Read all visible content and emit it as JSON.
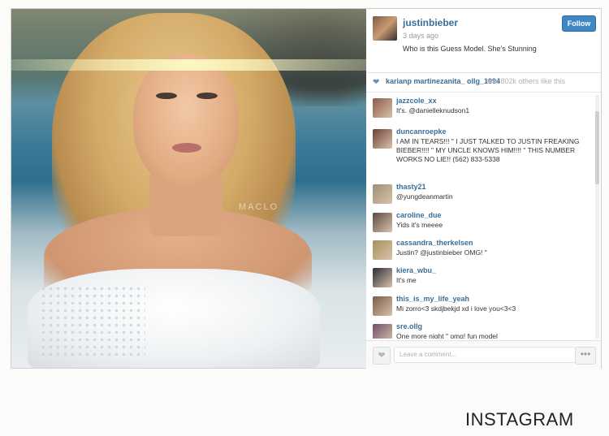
{
  "photo": {
    "watermark": "MACLO"
  },
  "post": {
    "username": "justinbieber",
    "time": "3 days ago",
    "caption": "Who is this Guess Model. She's Stunning",
    "follow_label": "Follow",
    "likes_names": "karianp  martinezanita_  ollg_1994",
    "likes_more": "and 802k others like this"
  },
  "comments": [
    {
      "user": "jazzcole_xx",
      "text": "It's. @danielleknudson1",
      "avatar_color": "#8a5a4a"
    },
    {
      "user": "duncanroepke",
      "text": "I AM IN TEARS!!! \" I JUST TALKED TO JUSTIN FREAKING BIEBER!!!! \" MY UNCLE KNOWS HIM!!!! \" THIS NUMBER WORKS NO LIE!! (562) 833-5338",
      "avatar_color": "#6b3f3a"
    },
    {
      "user": "thasty21",
      "text": "@yungdeanmartin",
      "avatar_color": "#9c8f78"
    },
    {
      "user": "caroline_due",
      "text": "Yids it's meeee",
      "avatar_color": "#5e4b43"
    },
    {
      "user": "cassandra_therkelsen",
      "text": "Justin? @justinbieber OMG! \"",
      "avatar_color": "#a79160"
    },
    {
      "user": "kiera_wbu_",
      "text": "It's me",
      "avatar_color": "#2b2b3a"
    },
    {
      "user": "this_is_my_life_yeah",
      "text": "Mi zorro<3 skdjbekjd xd i love you<3<3",
      "avatar_color": "#7a5a48"
    },
    {
      "user": "sre.ollg",
      "text": "One more night \" omg! fun model",
      "avatar_color": "#6f4e6b"
    }
  ],
  "comment_bar": {
    "placeholder": "Leave a comment...",
    "more_label": "•••"
  },
  "caption_label": "INSTAGRAM"
}
